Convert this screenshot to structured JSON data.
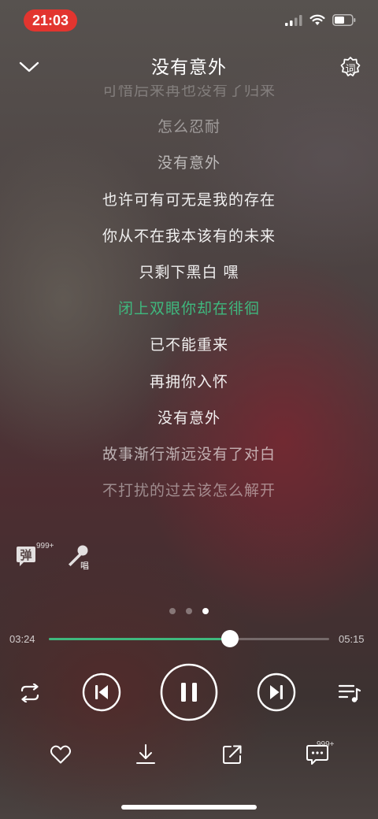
{
  "status_bar": {
    "time": "21:03",
    "icons": [
      "signal-icon",
      "wifi-icon",
      "battery-icon"
    ]
  },
  "header": {
    "title": "没有意外",
    "lyric_icon_char": "词"
  },
  "lyrics": [
    {
      "text": "可惜后来再也没有了归来",
      "state": "faded"
    },
    {
      "text": "怎么忍耐",
      "state": "dim"
    },
    {
      "text": "没有意外",
      "state": "mid"
    },
    {
      "text": "也许可有可无是我的存在",
      "state": "normal"
    },
    {
      "text": "你从不在我本该有的未来",
      "state": "normal"
    },
    {
      "text": "只剩下黑白 嘿",
      "state": "normal"
    },
    {
      "text": "闭上双眼你却在徘徊",
      "state": "active"
    },
    {
      "text": "已不能重来",
      "state": "normal"
    },
    {
      "text": "再拥你入怀",
      "state": "normal"
    },
    {
      "text": "没有意外",
      "state": "normal"
    },
    {
      "text": "故事渐行渐远没有了对白",
      "state": "mid"
    },
    {
      "text": "不打扰的过去该怎么解开",
      "state": "dim"
    }
  ],
  "side_actions": {
    "danmaku_char": "弹",
    "danmaku_count": "999+",
    "sing_char": "唱"
  },
  "pager": {
    "count": 3,
    "active": 2
  },
  "playback": {
    "current_time": "03:24",
    "total_time": "05:15",
    "progress": 0.647
  },
  "bottom_actions": {
    "comment_count": "999+"
  },
  "colors": {
    "accent": "#3fb87e",
    "time_pill": "#e2352f"
  }
}
